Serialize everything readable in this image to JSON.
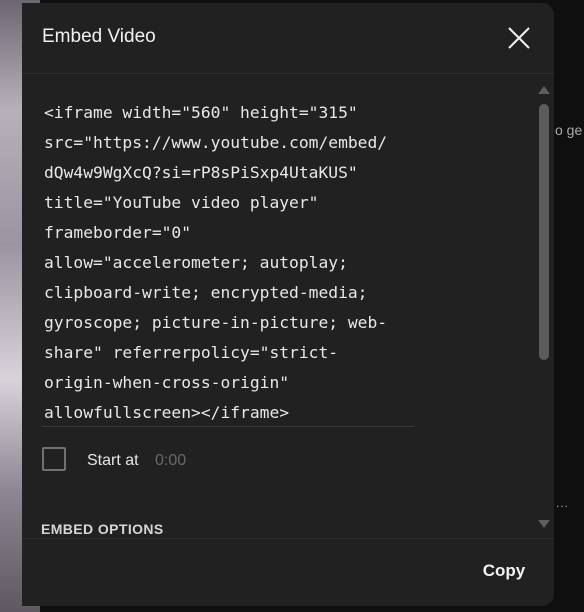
{
  "dialog": {
    "title": "Embed Video",
    "close_icon": "close-icon",
    "embed_code": "<iframe width=\"560\" height=\"315\"\nsrc=\"https://www.youtube.com/embed/\ndQw4w9WgXcQ?si=rP8sPiSxp4UtaKUS\"\ntitle=\"YouTube video player\"\nframeborder=\"0\"\nallow=\"accelerometer; autoplay;\nclipboard-write; encrypted-media;\ngyroscope; picture-in-picture; web-\nshare\" referrerpolicy=\"strict-\norigin-when-cross-origin\"\nallowfullscreen></iframe>",
    "start_at": {
      "checked": false,
      "label": "Start at",
      "time": "0:00"
    },
    "options_heading": "EMBED OPTIONS",
    "copy_label": "Copy"
  },
  "background": {
    "peek_text": "o ge",
    "overflow_dots": "..."
  },
  "colors": {
    "dialog_bg": "#212121",
    "page_bg": "#0f0f0f",
    "text": "#f1f1f1",
    "muted": "#6a6a6a",
    "scrollbar": "#5c5c5c"
  }
}
